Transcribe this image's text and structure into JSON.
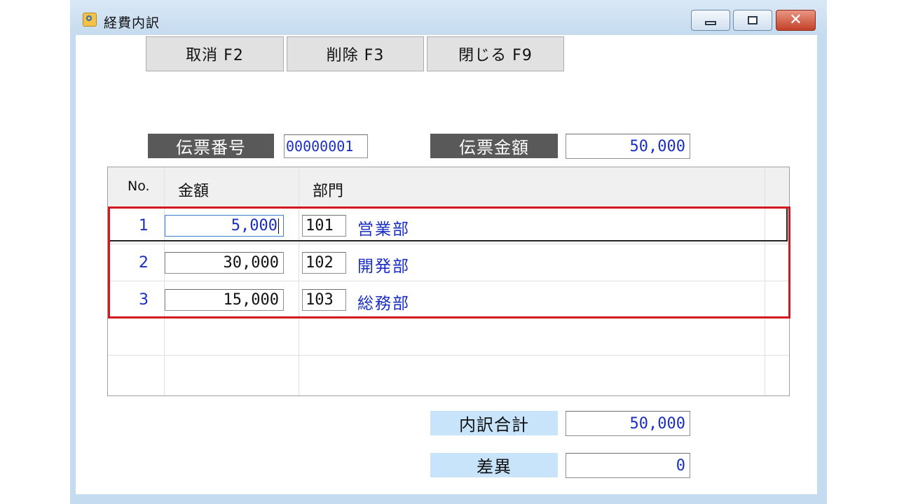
{
  "window": {
    "title": "経費内訳",
    "controls": {
      "minimize": "minimize-icon",
      "maximize": "maximize-icon",
      "close": "close-icon"
    }
  },
  "toolbar": {
    "cancel_label": "取消 F2",
    "delete_label": "削除 F3",
    "close_label": "閉じる F9"
  },
  "voucher": {
    "number_label": "伝票番号",
    "number_value": "00000001",
    "amount_label": "伝票金額",
    "amount_value": "50,000"
  },
  "grid": {
    "columns": [
      "No.",
      "金額",
      "部門"
    ],
    "rows": [
      {
        "no": "1",
        "amount": "5,000",
        "dept_code": "101",
        "dept_name": "営業部"
      },
      {
        "no": "2",
        "amount": "30,000",
        "dept_code": "102",
        "dept_name": "開発部"
      },
      {
        "no": "3",
        "amount": "15,000",
        "dept_code": "103",
        "dept_name": "総務部"
      }
    ]
  },
  "summary": {
    "total_label": "内訳合計",
    "total_value": "50,000",
    "diff_label": "差異",
    "diff_value": "0"
  },
  "colors": {
    "value_text": "#1a2ec4",
    "highlight_border": "#d2191f",
    "dark_label_bg": "#595959",
    "light_label_bg": "#c7e4fb"
  }
}
